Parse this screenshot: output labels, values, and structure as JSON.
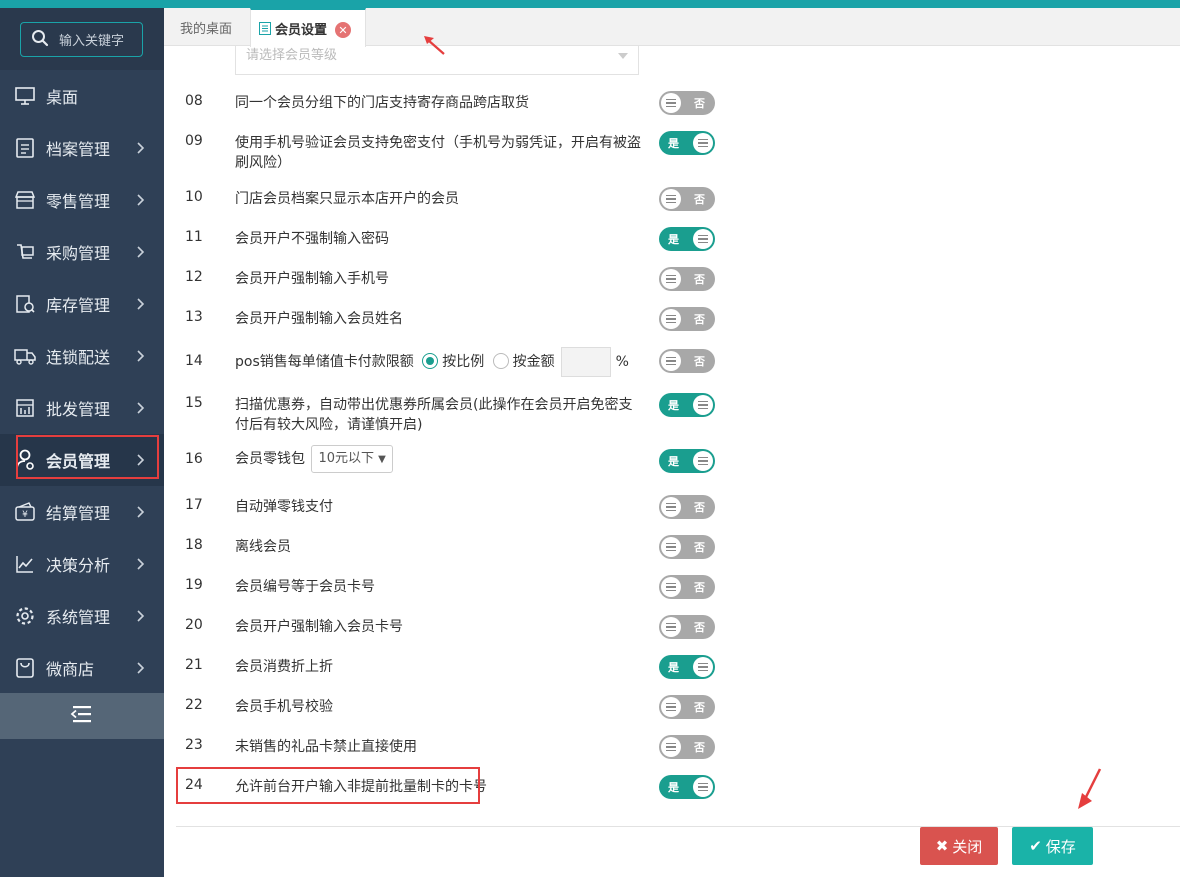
{
  "search": {
    "label": "输入关键字"
  },
  "sidebar": {
    "items": [
      {
        "label": "桌面",
        "icon": "monitor-icon",
        "has_arrow": false
      },
      {
        "label": "档案管理",
        "icon": "file-icon",
        "has_arrow": true
      },
      {
        "label": "零售管理",
        "icon": "store-icon",
        "has_arrow": true
      },
      {
        "label": "采购管理",
        "icon": "purchase-icon",
        "has_arrow": true
      },
      {
        "label": "库存管理",
        "icon": "inventory-icon",
        "has_arrow": true
      },
      {
        "label": "连锁配送",
        "icon": "truck-icon",
        "has_arrow": true
      },
      {
        "label": "批发管理",
        "icon": "wholesale-icon",
        "has_arrow": true
      },
      {
        "label": "会员管理",
        "icon": "member-icon",
        "has_arrow": true,
        "active": true
      },
      {
        "label": "结算管理",
        "icon": "settlement-icon",
        "has_arrow": true
      },
      {
        "label": "决策分析",
        "icon": "chart-icon",
        "has_arrow": true
      },
      {
        "label": "系统管理",
        "icon": "gear-icon",
        "has_arrow": true
      },
      {
        "label": "微商店",
        "icon": "shop-bag-icon",
        "has_arrow": true
      }
    ]
  },
  "tabs": {
    "home": "我的桌面",
    "active": "会员设置"
  },
  "dropdown": {
    "placeholder": "请选择会员等级"
  },
  "settings": [
    {
      "num": "08",
      "text": "同一个会员分组下的门店支持寄存商品跨店取货",
      "state": "否"
    },
    {
      "num": "09",
      "text": "使用手机号验证会员支持免密支付（手机号为弱凭证，开启有被盗刷风险）",
      "state": "是"
    },
    {
      "num": "10",
      "text": "门店会员档案只显示本店开户的会员",
      "state": "否"
    },
    {
      "num": "11",
      "text": "会员开户不强制输入密码",
      "state": "是"
    },
    {
      "num": "12",
      "text": "会员开户强制输入手机号",
      "state": "否"
    },
    {
      "num": "13",
      "text": "会员开户强制输入会员姓名",
      "state": "否"
    },
    {
      "num": "14",
      "text": "pos销售每单储值卡付款限额",
      "opt1": "按比例",
      "opt2": "按金额",
      "unit": "%",
      "state": "否"
    },
    {
      "num": "15",
      "text": "扫描优惠券，自动带出优惠券所属会员(此操作在会员开启免密支付后有较大风险，请谨慎开启)",
      "state": "是"
    },
    {
      "num": "16",
      "text": "会员零钱包",
      "select": "10元以下",
      "state": "是"
    },
    {
      "num": "17",
      "text": "自动弹零钱支付",
      "state": "否"
    },
    {
      "num": "18",
      "text": "离线会员",
      "state": "否"
    },
    {
      "num": "19",
      "text": "会员编号等于会员卡号",
      "state": "否"
    },
    {
      "num": "20",
      "text": "会员开户强制输入会员卡号",
      "state": "否"
    },
    {
      "num": "21",
      "text": "会员消费折上折",
      "state": "是"
    },
    {
      "num": "22",
      "text": "会员手机号校验",
      "state": "否"
    },
    {
      "num": "23",
      "text": "未销售的礼品卡禁止直接使用",
      "state": "否"
    },
    {
      "num": "24",
      "text": "允许前台开户输入非提前批量制卡的卡号",
      "state": "是"
    }
  ],
  "buttons": {
    "close": "关闭",
    "save": "保存"
  },
  "colors": {
    "accent": "#1aa3a8",
    "toggle_on": "#1a9e8f",
    "toggle_off": "#a8a8a8",
    "danger": "#d9534f",
    "highlight": "#e53e3e"
  }
}
